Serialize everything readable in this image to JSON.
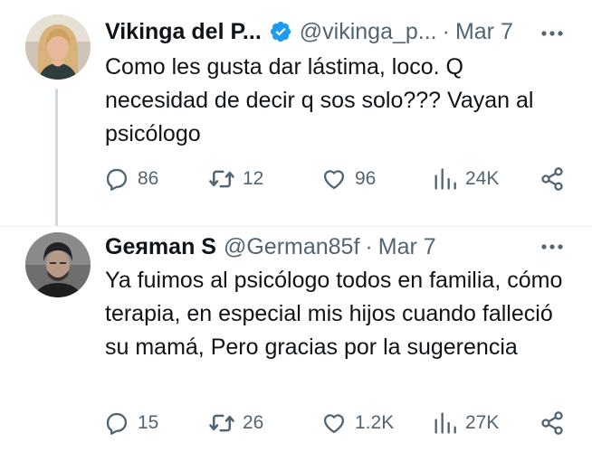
{
  "tweets": [
    {
      "name": "Vikinga del P...",
      "handle": "@vikinga_p...",
      "separator": "·",
      "date": "Mar 7",
      "verified": true,
      "text": "Como les gusta dar lástima, loco. Q necesidad de decir q sos solo??? Vayan al psicólogo",
      "replies": "86",
      "retweets": "12",
      "likes": "96",
      "views": "24K"
    },
    {
      "name": "Geяman S",
      "handle": "@German85f",
      "separator": "·",
      "date": "Mar 7",
      "verified": false,
      "text": "Ya fuimos al psicólogo todos en familia, cómo terapia, en especial mis hijos cuando falleció su mamá, Pero gracias por la sugerencia",
      "replies": "15",
      "retweets": "26",
      "likes": "1.2K",
      "views": "27K"
    }
  ],
  "icons": {
    "reply": "reply-icon",
    "retweet": "retweet-icon",
    "like": "heart-icon",
    "views": "views-icon",
    "share": "share-icon",
    "more": "more-icon",
    "verified": "verified-badge-icon"
  },
  "colors": {
    "text": "#0f1419",
    "secondary": "#536471",
    "verified": "#1d9bf0",
    "thread_line": "#cfd9de"
  }
}
